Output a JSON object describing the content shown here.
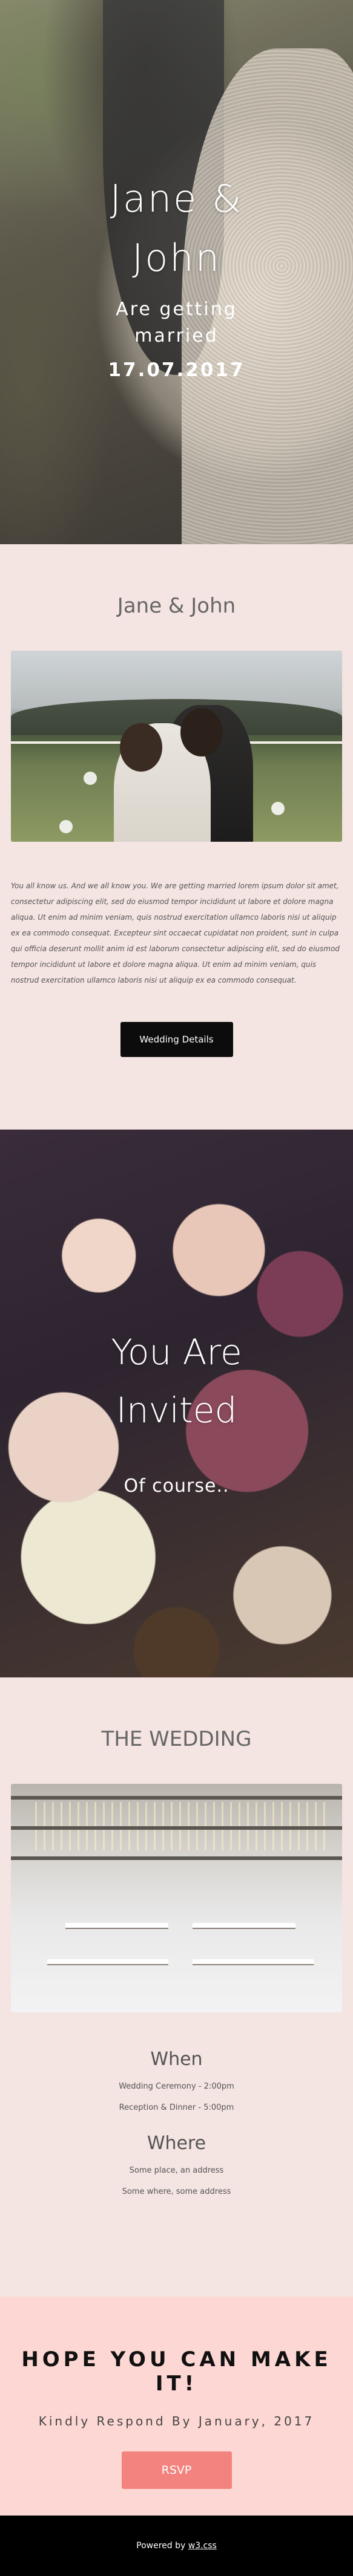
{
  "hero": {
    "title": "Jane &\nJohn",
    "subtitle": "Are getting\nmarried",
    "date": "17.07.2017"
  },
  "story": {
    "title": "Jane & John",
    "paragraph": "You all know us. And we all know you. We are getting married lorem ipsum dolor sit amet, consectetur adipiscing elit, sed do eiusmod tempor incididunt ut labore et dolore magna aliqua. Ut enim ad minim veniam, quis nostrud exercitation ullamco laboris nisi ut aliquip ex ea commodo consequat. Excepteur sint occaecat cupidatat non proident, sunt in culpa qui officia deserunt mollit anim id est laborum consectetur adipiscing elit, sed do eiusmod tempor incididunt ut labore et dolore magna aliqua. Ut enim ad minim veniam, quis nostrud exercitation ullamco laboris nisi ut aliquip ex ea commodo consequat.",
    "button_label": "Wedding Details"
  },
  "invited": {
    "title": "You Are\nInvited",
    "subtitle": "Of course.."
  },
  "wedding": {
    "title": "THE WEDDING",
    "when_heading": "When",
    "when_lines": [
      "Wedding Ceremony - 2:00pm",
      "Reception & Dinner - 5:00pm"
    ],
    "where_heading": "Where",
    "where_lines": [
      "Some place, an address",
      "Some where, some address"
    ]
  },
  "rsvp": {
    "title": "HOPE YOU CAN MAKE IT!",
    "subtitle": "Kindly Respond By January, 2017",
    "button_label": "RSVP",
    "button_color": "#f2837e",
    "background": "#fdd7d4"
  },
  "footer": {
    "prefix": "Powered by ",
    "link_text": "w3.css"
  }
}
